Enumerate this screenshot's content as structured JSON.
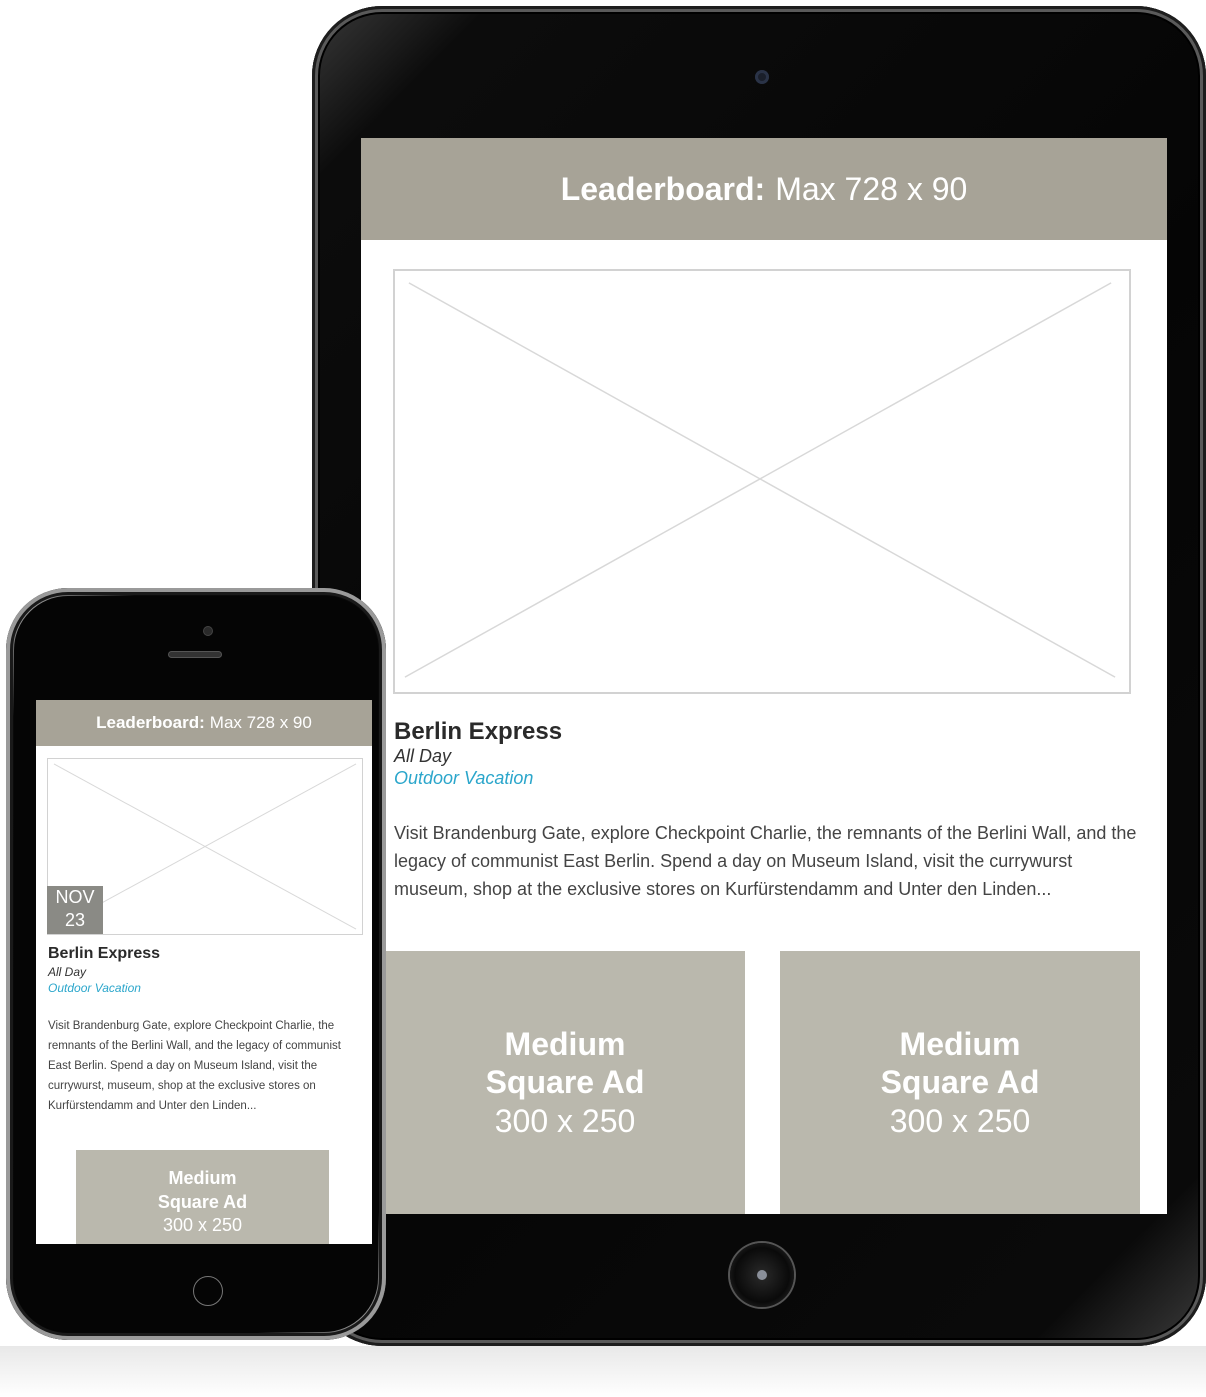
{
  "tablet": {
    "leaderboard": {
      "bold": "Leaderboard:",
      "text": "Max 728 x 90"
    },
    "event": {
      "title": "Berlin Express",
      "time": "All Day",
      "category": "Outdoor Vacation",
      "description": "Visit Brandenburg Gate, explore Checkpoint Charlie, the remnants of the Berlini Wall, and the legacy of communist East Berlin. Spend a day on Museum Island, visit the currywurst museum, shop at the exclusive stores on Kurfürstendamm and Unter den Linden..."
    },
    "ads": [
      {
        "line1": "Medium",
        "line2": "Square Ad",
        "size": "300 x 250"
      },
      {
        "line1": "Medium",
        "line2": "Square Ad",
        "size": "300 x 250"
      }
    ]
  },
  "phone": {
    "leaderboard": {
      "bold": "Leaderboard:",
      "text": "Max 728 x 90"
    },
    "date": {
      "month": "NOV",
      "day": "23"
    },
    "event": {
      "title": "Berlin Express",
      "time": "All Day",
      "category": "Outdoor Vacation",
      "description": "Visit Brandenburg Gate, explore Checkpoint Charlie, the remnants of the Berlini Wall, and the legacy of communist East Berlin. Spend a day on Museum Island, visit the currywurst, museum, shop at the exclusive stores on Kurfürstendamm and Unter den Linden..."
    },
    "ad": {
      "line1": "Medium",
      "line2": "Square Ad",
      "size": "300 x 250"
    }
  },
  "colors": {
    "leaderboard_bg": "#a7a397",
    "ad_bg": "#bab8ad",
    "category_link": "#2ba6cb",
    "date_badge_bg": "#8a8a85"
  },
  "icons": [
    "image-placeholder-icon",
    "camera-icon",
    "home-button-icon"
  ]
}
